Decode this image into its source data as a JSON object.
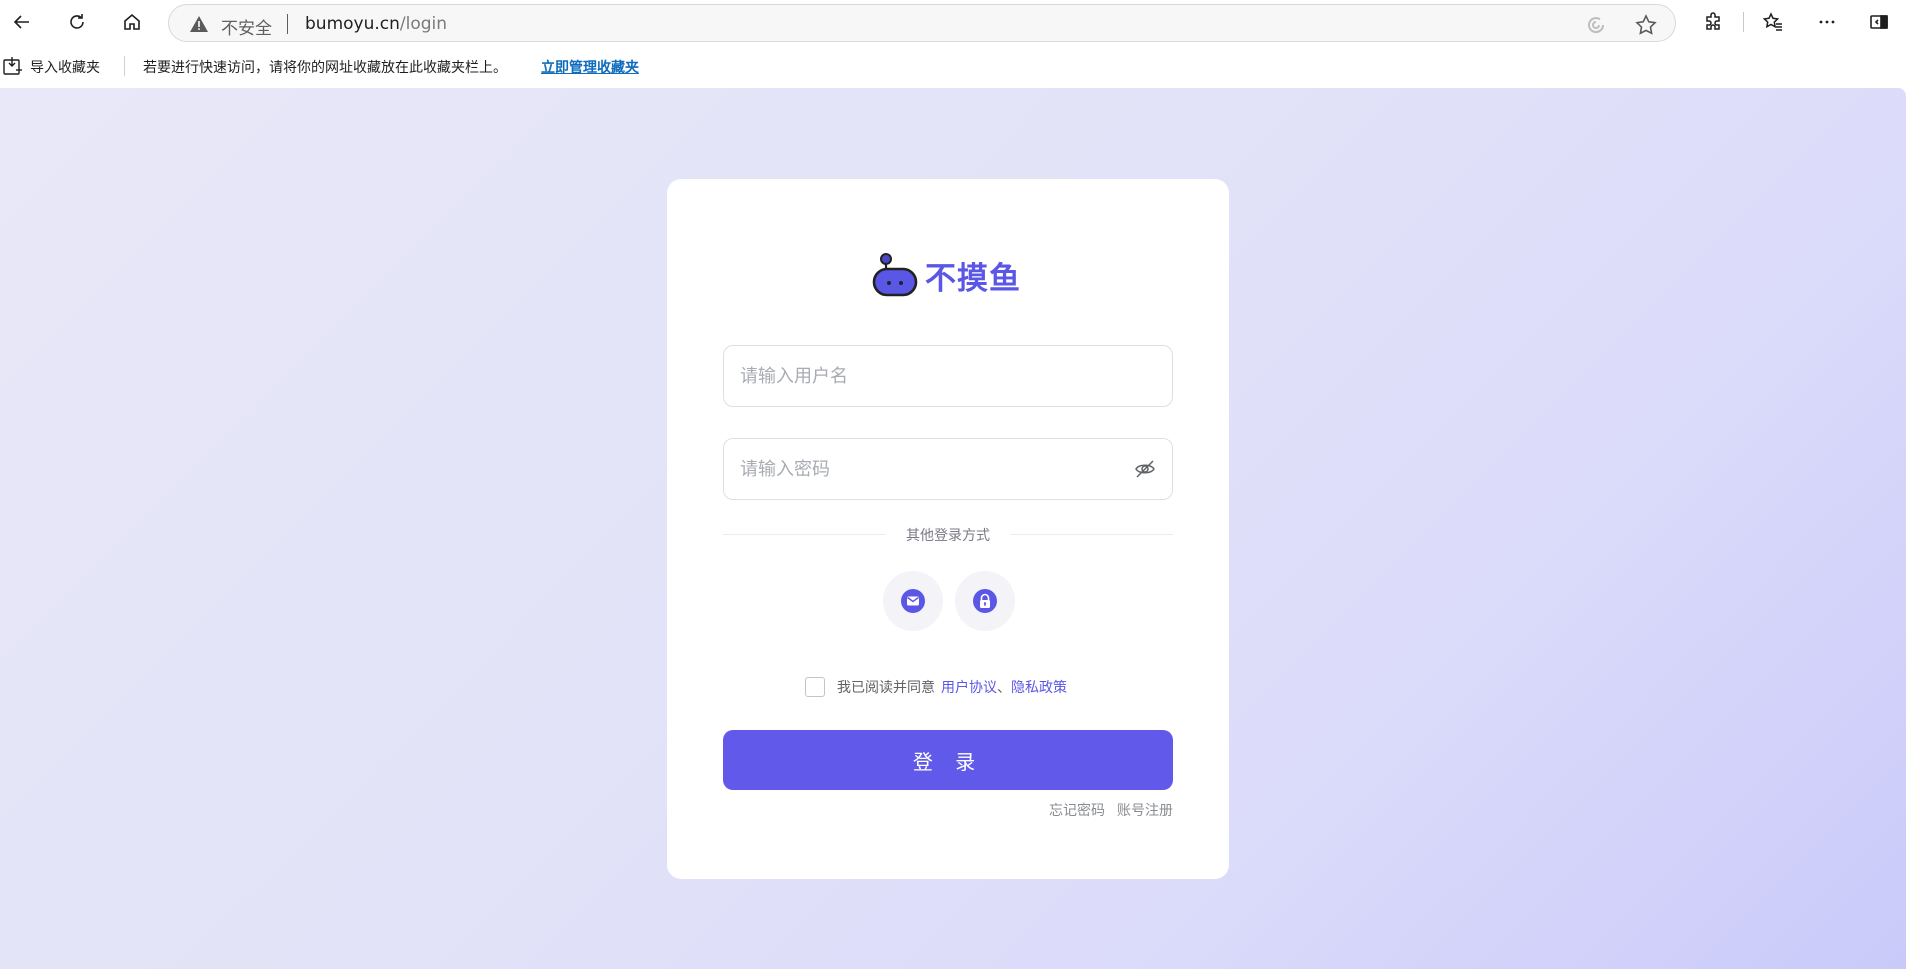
{
  "browser": {
    "security_label": "不安全",
    "url_host": "bumoyu.cn",
    "url_path": "/login",
    "icons": [
      "back-icon",
      "refresh-icon",
      "home-icon",
      "warning-icon",
      "edge-refresh-icon",
      "favorite-star-icon",
      "extensions-icon",
      "favorites-icon",
      "more-icon",
      "sidebar-icon"
    ]
  },
  "bookmarks": {
    "import_label": "导入收藏夹",
    "hint": "若要进行快速访问，请将你的网址收藏放在此收藏夹栏上。",
    "manage_link": "立即管理收藏夹"
  },
  "login": {
    "brand_name": "不摸鱼",
    "username_placeholder": "请输入用户名",
    "password_placeholder": "请输入密码",
    "other_methods_label": "其他登录方式",
    "agree_text": "我已阅读并同意",
    "user_agreement": "用户协议",
    "separator": "、",
    "privacy_policy": "隐私政策",
    "login_button": "登 录",
    "forgot_password": "忘记密码",
    "register": "账号注册",
    "accent_color": "#6159ea"
  }
}
